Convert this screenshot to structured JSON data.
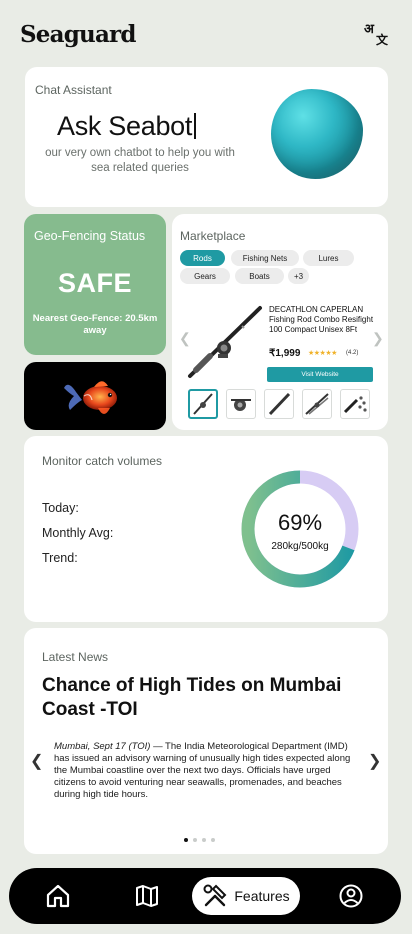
{
  "app": {
    "title": "Seaguard"
  },
  "chat": {
    "label": "Chat Assistant",
    "title": "Ask Seabot",
    "subtitle": "our very own chatbot to help you with sea related queries"
  },
  "geofence": {
    "label": "Geo-Fencing Status",
    "status": "SAFE",
    "nearest": "Nearest Geo-Fence: 20.5km away"
  },
  "market": {
    "label": "Marketplace",
    "chips": [
      "Rods",
      "Fishing Nets",
      "Lures",
      "Gears",
      "Boats",
      "+3"
    ],
    "active_chip": "Rods",
    "product": {
      "name": "DECATHLON CAPERLAN Fishing Rod Combo Resifight 100 Compact Unisex 8Ft",
      "price": "₹1,999",
      "stars": "★★★★★",
      "rating": "(4.2)",
      "button": "Visit Website"
    },
    "prev_icon": "chevron-left-icon",
    "next_icon": "chevron-right-icon"
  },
  "catch": {
    "label": "Monitor catch volumes",
    "today": "Today:",
    "monthly": "Monthly Avg:",
    "trend": "Trend:",
    "percent": "69%",
    "percent_value": 0.69,
    "amount": "280kg/500kg"
  },
  "news": {
    "label": "Latest News",
    "headline": "Chance of High Tides on Mumbai Coast -TOI",
    "dateline": "Mumbai, Sept 17 (TOI)",
    "body": " — The India Meteorological Department (IMD) has issued an advisory warning of unusually high tides expected along the Mumbai coastline over the next two days. Officials have urged citizens to avoid venturing near seawalls, promenades, and beaches during high tide hours.",
    "pages": 4,
    "active_page": 0
  },
  "bottom_nav": {
    "features_label": "Features",
    "icons": [
      "home-icon",
      "map-icon",
      "tools-icon",
      "profile-icon"
    ]
  },
  "colors": {
    "accent": "#1f9aa3",
    "geo_green": "#86bb8e",
    "ring_green": "#69b58d",
    "ring_lilac": "#d7ccf4"
  }
}
